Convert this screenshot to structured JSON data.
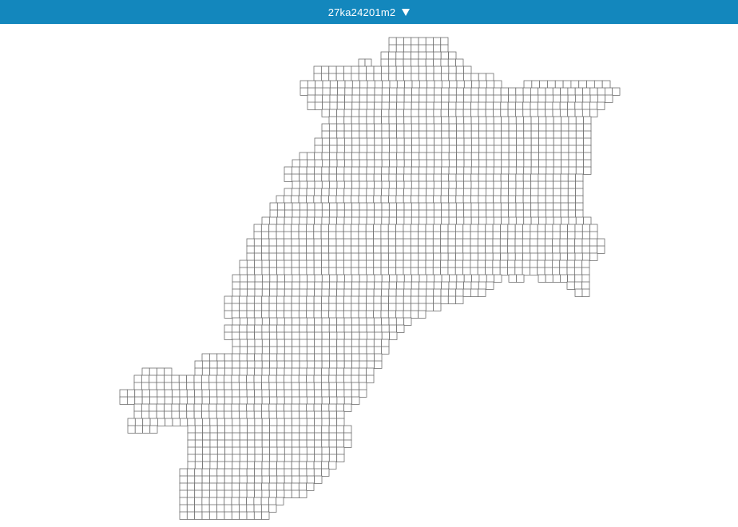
{
  "header": {
    "selected_area": "27ka24201m2"
  },
  "colors": {
    "header_bg": "#1387bd",
    "header_text": "#ffffff",
    "cell_stroke": "#6f6f6f",
    "cell_fill": "#ffffff"
  },
  "icons": {
    "dropdown": "caret-down-icon"
  }
}
